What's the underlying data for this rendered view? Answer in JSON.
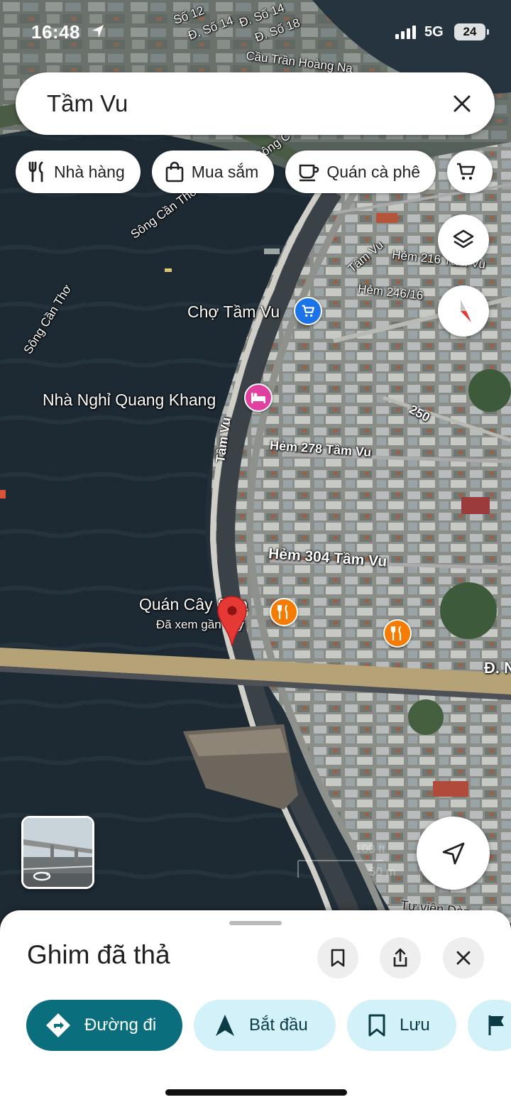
{
  "status_bar": {
    "time": "16:48",
    "network": "5G",
    "battery": "24"
  },
  "search": {
    "query": "Tầm Vu"
  },
  "chips": [
    {
      "label": "Nhà hàng",
      "icon": "restaurant-icon"
    },
    {
      "label": "Mua sắm",
      "icon": "shopping-bag-icon"
    },
    {
      "label": "Quán cà phê",
      "icon": "coffee-icon"
    },
    {
      "label": "",
      "icon": "cart-icon"
    }
  ],
  "map": {
    "labels": {
      "so12": "Số 12",
      "dso14": "Đ. Số 14",
      "dso14b": "Đ. Số 14",
      "dso18": "Đ. Số 18",
      "cau_tran_hoang_na": "Cầu Trần Hoàng Na",
      "song_can_tho_1": "Sông Cần Thơ",
      "song_can_tho_2": "Sông Cần Thơ",
      "song_can_tho_3": "Sông C",
      "tam_vu_top": "Tầm Vu",
      "hem_216": "Hẻm 216 Tầm Vu",
      "hem_246": "Hẻm 246/16",
      "cho_tam_vu": "Chợ Tầm Vu",
      "nha_nghi": "Nhà Nghỉ Quang Khang",
      "road_250": "250",
      "hem_278": "Hẻm 278 Tầm Vu",
      "tam_vu_road": "Tầm Vu",
      "hem_304": "Hẻm 304 Tầm Vu",
      "quan_cay_sua": "Quán Cây Sữa",
      "da_xem": "Đã xem gần đây",
      "duong_right": "Đ. N",
      "thu_vien": "Tư viện Dàng",
      "scale_1": "100 ft",
      "scale_2": "50 m"
    }
  },
  "bottom_sheet": {
    "title": "Ghim đã thả",
    "actions": [
      {
        "label": "Đường đi",
        "icon": "directions-icon"
      },
      {
        "label": "Bắt đầu",
        "icon": "navigation-arrow-icon"
      },
      {
        "label": "Lưu",
        "icon": "bookmark-icon"
      },
      {
        "label": "",
        "icon": "flag-icon"
      }
    ]
  },
  "colors": {
    "accent": "#0a6e7d",
    "action_bg": "#d3f1f8",
    "pin": "#e53935",
    "poi_food": "#f57c00",
    "poi_shop": "#1a73e8",
    "poi_hotel": "#e040a0"
  }
}
